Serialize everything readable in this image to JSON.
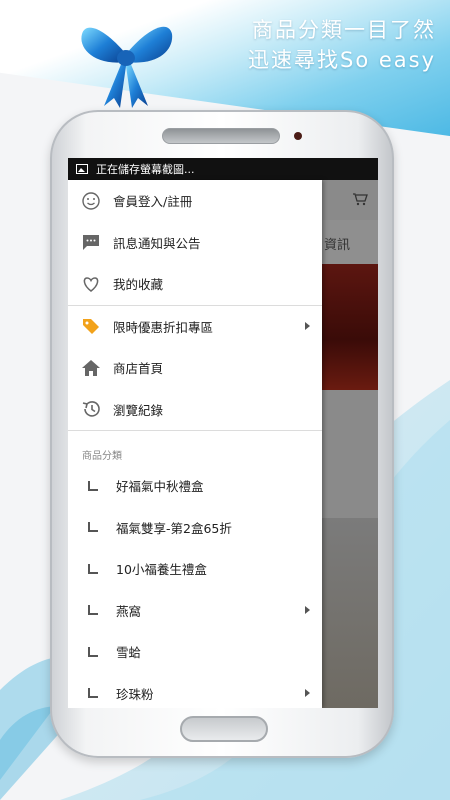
{
  "promo": {
    "line1": "商品分類一目了然",
    "line2": "迅速尋找So easy"
  },
  "statusbar": {
    "icon": "image-icon",
    "text": "正在儲存螢幕截圖..."
  },
  "app_behind": {
    "cart_icon": "cart-icon",
    "tab_text": "資訊"
  },
  "drawer": {
    "items": [
      {
        "label": "會員登入/註冊",
        "icon": "smiley-icon"
      },
      {
        "label": "訊息通知與公告",
        "icon": "chat-icon"
      },
      {
        "label": "我的收藏",
        "icon": "heart-icon"
      }
    ],
    "items2": [
      {
        "label": "限時優惠折扣專區",
        "icon": "tag-icon",
        "has_arrow": true
      },
      {
        "label": "商店首頁",
        "icon": "home-icon"
      },
      {
        "label": "瀏覽紀錄",
        "icon": "history-icon"
      }
    ],
    "section_label": "商品分類",
    "categories": [
      {
        "label": "好福氣中秋禮盒",
        "has_arrow": false
      },
      {
        "label": "福氣雙享-第2盒65折",
        "has_arrow": false
      },
      {
        "label": "10小福養生禮盒",
        "has_arrow": false
      },
      {
        "label": "燕窩",
        "has_arrow": true
      },
      {
        "label": "雪蛤",
        "has_arrow": false
      },
      {
        "label": "珍珠粉",
        "has_arrow": true
      }
    ]
  },
  "colors": {
    "accent_tag": "#f2a21b",
    "icon_gray": "#666666",
    "promo_blue": "#4bb8e4"
  }
}
